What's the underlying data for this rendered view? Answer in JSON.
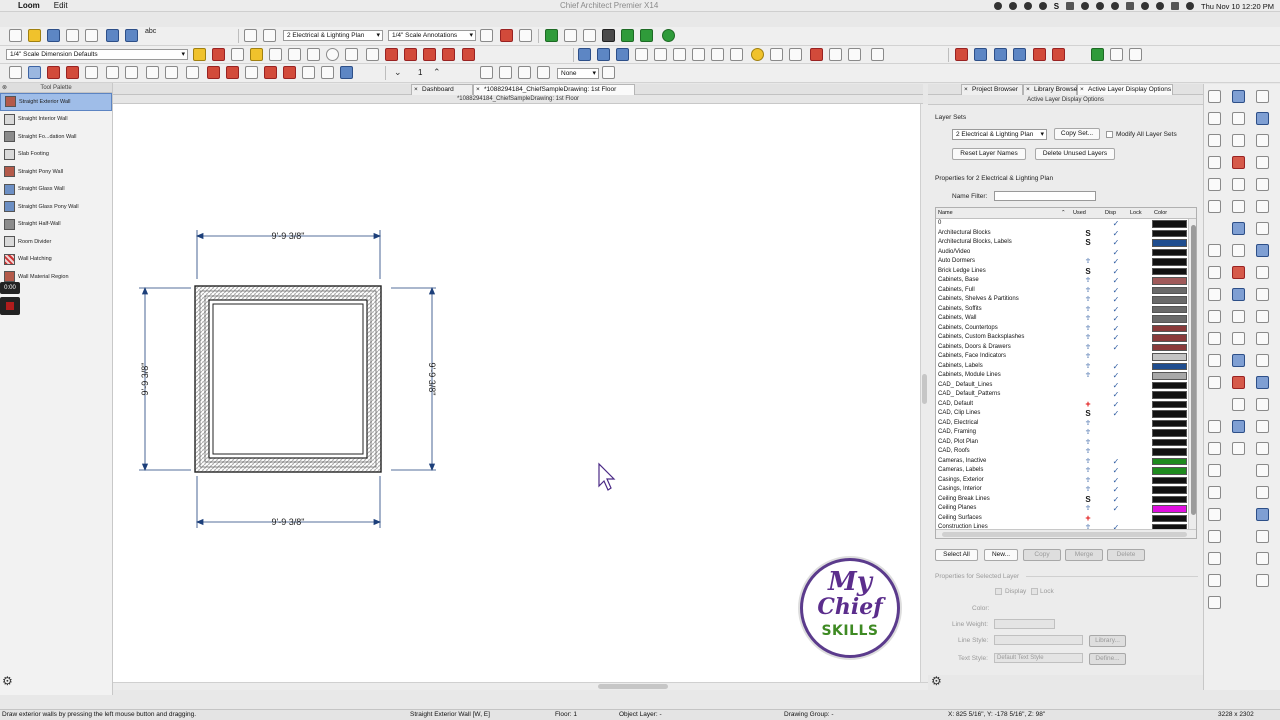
{
  "menubar": {
    "app_name": "Loom",
    "menu_edit": "Edit",
    "window_title": "Chief Architect Premier X14",
    "datetime": "Thu Nov 10  12:20 PM",
    "tray_s": "S"
  },
  "toolbar1": {
    "layer_set_dropdown": "2 Electrical & Lighting Plan",
    "annotation_dropdown": "1/4\" Scale Annotations",
    "spell_label": "abc"
  },
  "toolbar2": {
    "dimension_defaults_dropdown": "1/4\" Scale Dimension Defaults"
  },
  "toolbar3": {
    "floor_number": "1",
    "none_dropdown": "None"
  },
  "palette": {
    "title": "Tool Palette",
    "items": [
      {
        "label": "Straight Exterior Wall"
      },
      {
        "label": "Straight Interior Wall"
      },
      {
        "label": "Straight Fo...dation Wall"
      },
      {
        "label": "Slab Footing"
      },
      {
        "label": "Straight Pony Wall"
      },
      {
        "label": "Straight Glass Wall"
      },
      {
        "label": "Straight Glass Pony Wall"
      },
      {
        "label": "Straight Half-Wall"
      },
      {
        "label": "Room Divider"
      },
      {
        "label": "Wall Hatching"
      },
      {
        "label": "Wall Material Region"
      }
    ],
    "recording_time": "0:00"
  },
  "tabs": {
    "dashboard": "Dashboard",
    "drawing": "*1088294184_ChiefSampleDrawing: 1st Floor",
    "close_glyph": "×"
  },
  "document_title": "*1088294184_ChiefSampleDrawing: 1st Floor",
  "drawing": {
    "dim_top": "9'-9 3/8\"",
    "dim_bottom": "9'-9 3/8\"",
    "dim_left": "9'-9 3/8\"",
    "dim_right": "9'-9 3/8\""
  },
  "logo": {
    "line1": "My",
    "line2": "Chief",
    "line3": "SKILLS"
  },
  "right_panel": {
    "tabs": [
      {
        "label": "Project Browser"
      },
      {
        "label": "Library Browser"
      },
      {
        "label": "Active Layer Display Options"
      }
    ],
    "title": "Active Layer Display Options",
    "layer_sets_label": "Layer Sets",
    "layer_set_dropdown": "2 Electrical & Lighting Plan",
    "copy_set_button": "Copy Set...",
    "modify_all_label": "Modify All Layer Sets",
    "reset_names_button": "Reset Layer Names",
    "delete_unused_button": "Delete Unused Layers",
    "properties_for_label": "Properties for 2 Electrical & Lighting Plan",
    "name_filter_label": "Name Filter:",
    "name_filter_value": "",
    "columns": {
      "name": "Name",
      "used": "Used",
      "disp": "Disp",
      "lock": "Lock",
      "color": "Color"
    },
    "layers": [
      {
        "name": "0",
        "used": "",
        "disp": true,
        "color": "#111111"
      },
      {
        "name": "Architectural Blocks",
        "used": "S",
        "disp": true,
        "color": "#111111"
      },
      {
        "name": "Architectural Blocks, Labels",
        "used": "S",
        "disp": true,
        "color": "#1f4d8f"
      },
      {
        "name": "Audio/Video",
        "used": "",
        "disp": true,
        "color": "#111111"
      },
      {
        "name": "Auto Dormers",
        "used": "g",
        "disp": true,
        "color": "#111111"
      },
      {
        "name": "Brick Ledge Lines",
        "used": "S",
        "disp": true,
        "color": "#111111"
      },
      {
        "name": "Cabinets,  Base",
        "used": "g",
        "disp": true,
        "color": "#a05a5a"
      },
      {
        "name": "Cabinets,  Full",
        "used": "g",
        "disp": true,
        "color": "#6a6a6a"
      },
      {
        "name": "Cabinets,  Shelves & Partitions",
        "used": "g",
        "disp": true,
        "color": "#6a6a6a"
      },
      {
        "name": "Cabinets,  Soffits",
        "used": "g",
        "disp": true,
        "color": "#6a6a6a"
      },
      {
        "name": "Cabinets,  Wall",
        "used": "g",
        "disp": true,
        "color": "#6a6a6a"
      },
      {
        "name": "Cabinets, Countertops",
        "used": "g",
        "disp": true,
        "color": "#8a3a3a"
      },
      {
        "name": "Cabinets, Custom Backsplashes",
        "used": "g",
        "disp": true,
        "color": "#8a3a3a"
      },
      {
        "name": "Cabinets, Doors & Drawers",
        "used": "g",
        "disp": true,
        "color": "#8a3a3a"
      },
      {
        "name": "Cabinets, Face Indicators",
        "used": "g",
        "disp": false,
        "color": "#c4c4c4"
      },
      {
        "name": "Cabinets, Labels",
        "used": "g",
        "disp": true,
        "color": "#1f4d8f"
      },
      {
        "name": "Cabinets, Module Lines",
        "used": "g",
        "disp": true,
        "color": "#a8a8a8"
      },
      {
        "name": "CAD_  Default_Lines",
        "used": "",
        "disp": true,
        "color": "#111111"
      },
      {
        "name": "CAD_  Default_Patterns",
        "used": "",
        "disp": true,
        "color": "#111111"
      },
      {
        "name": "CAD,  Default",
        "used": "r",
        "disp": true,
        "color": "#111111"
      },
      {
        "name": "CAD, Clip Lines",
        "used": "S",
        "disp": true,
        "color": "#111111"
      },
      {
        "name": "CAD, Electrical",
        "used": "g",
        "disp": false,
        "color": "#111111"
      },
      {
        "name": "CAD, Framing",
        "used": "g",
        "disp": false,
        "color": "#111111"
      },
      {
        "name": "CAD, Plot Plan",
        "used": "g",
        "disp": false,
        "color": "#111111"
      },
      {
        "name": "CAD, Roofs",
        "used": "g",
        "disp": false,
        "color": "#111111"
      },
      {
        "name": "Cameras, Inactive",
        "used": "g",
        "disp": true,
        "color": "#1e8a1e"
      },
      {
        "name": "Cameras, Labels",
        "used": "g",
        "disp": true,
        "color": "#1e8a1e"
      },
      {
        "name": "Casings, Exterior",
        "used": "g",
        "disp": true,
        "color": "#111111"
      },
      {
        "name": "Casings, Interior",
        "used": "g",
        "disp": true,
        "color": "#111111"
      },
      {
        "name": "Ceiling Break Lines",
        "used": "S",
        "disp": true,
        "color": "#111111"
      },
      {
        "name": "Ceiling Planes",
        "used": "g",
        "disp": true,
        "color": "#e010e0"
      },
      {
        "name": "Ceiling Surfaces",
        "used": "r",
        "disp": false,
        "color": "#111111"
      },
      {
        "name": "Construction Lines",
        "used": "g",
        "disp": true,
        "color": "#111111"
      }
    ],
    "select_all_button": "Select All",
    "new_button": "New...",
    "copy_button": "Copy",
    "merge_button": "Merge",
    "delete_button": "Delete",
    "selected_layer_label": "Properties for Selected Layer",
    "display_label": "Display",
    "lock_label": "Lock",
    "color_label": "Color:",
    "line_weight_label": "Line Weight:",
    "line_style_label": "Line Style:",
    "library_button": "Library...",
    "text_style_label": "Text Style:",
    "text_style_value": "Default Text Style",
    "define_button": "Define..."
  },
  "statusbar": {
    "hint": "Draw exterior walls by pressing the left mouse button and dragging.",
    "tool": "Straight Exterior Wall [W, E]",
    "floor": "Floor: 1",
    "object_layer": "Object Layer: -",
    "drawing_group": "Drawing Group: -",
    "coordinates": "X: 825 5/16\", Y: -178 5/16\", Z: 98\"",
    "resolution": "3228 x 2302"
  }
}
